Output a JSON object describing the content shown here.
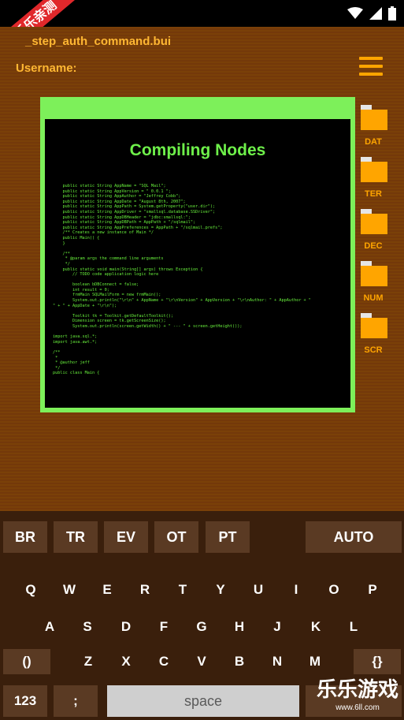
{
  "banner": "乐乐亲测",
  "app": {
    "title": "_step_auth_command.bui",
    "username_label": "Username:"
  },
  "screen": {
    "title": "Compiling Nodes",
    "code": "    public static String AppName = \"SQL Mail\";\n    public static String AppVersion = \" 0.0.1 \";\n    public static String AppAuthor = \"Jeffrey Cobb\";\n    public static String AppDate = \"August 8th, 2007\";\n    public static String AppPath = System.getProperty(\"user.dir\");\n    public static String AppDriver = \"smallsql.database.SSDriver\";\n    public static String AppDBHeader = \"jdbc:smallsql:\";\n    public static String AppDBPath = AppPath + \"/sqlmail\";\n    public static String AppPreferences = AppPath + \"/sqlmail.prefs\";\n    /** Creates a new instance of Main */\n    public Main() {\n    }\n\n    /**\n     * @param args the command line arguments\n     */\n    public static void main(String[] args) throws Exception {\n        // TODO code application logic here\n\n        boolean bDBConnect = false;\n        int result = 0;\n        frmMain SQLMailForm = new frmMain();\n        System.out.println(\"\\r\\n\" + AppName + \"\\r\\nVersion\" + AppVersion + \"\\r\\nAuthor: \" + AppAuthor + \"\n\" + \" + AppDate + \"\\r\\n\");\n\n        Toolkit tk = Toolkit.getDefaultToolkit();\n        Dimension screen = tk.getScreenSize();\n        System.out.println(screen.getWidth() + \" --- \" + screen.getHeight());\n\nimport java.sql.*;\nimport java.awt.*;\n\n/**\n *\n * @author jeff\n */\npublic class Main {"
  },
  "folders": [
    {
      "label": "DAT"
    },
    {
      "label": "TER"
    },
    {
      "label": "DEC"
    },
    {
      "label": "NUM"
    },
    {
      "label": "SCR"
    }
  ],
  "keyboard": {
    "top_row": [
      "BR",
      "TR",
      "EV",
      "OT",
      "PT"
    ],
    "auto": "AUTO",
    "row1": [
      "Q",
      "W",
      "E",
      "R",
      "T",
      "Y",
      "U",
      "I",
      "O",
      "P"
    ],
    "row2": [
      "A",
      "S",
      "D",
      "F",
      "G",
      "H",
      "J",
      "K",
      "L"
    ],
    "row3_left": "()",
    "row3": [
      "Z",
      "X",
      "C",
      "V",
      "B",
      "N",
      "M"
    ],
    "row3_right": "{}",
    "num": "123",
    "semicolon": ";",
    "space": "space"
  },
  "watermark": {
    "title": "乐乐游戏",
    "url": "www.6ll.com"
  },
  "colors": {
    "accent": "#ffa500",
    "monitor": "#7df05a",
    "code": "#68f03c",
    "banner": "#e0282b"
  }
}
